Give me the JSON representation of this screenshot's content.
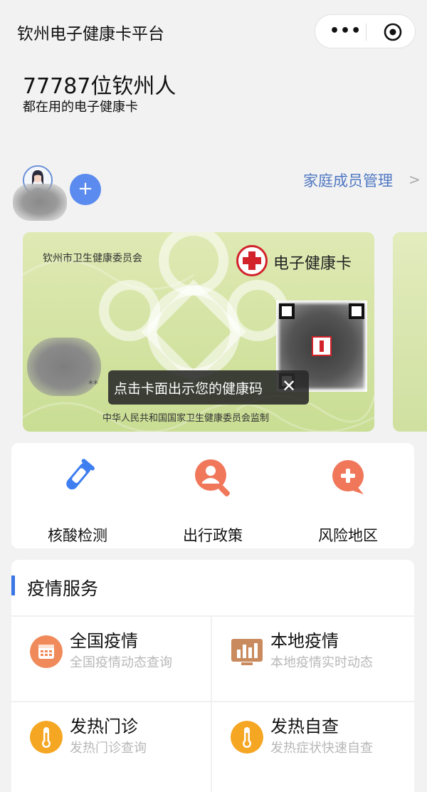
{
  "header": {
    "title": "钦州电子健康卡平台",
    "more_label": "•••"
  },
  "intro": {
    "count_line": "77787位钦州人",
    "sub_line": "都在用的电子健康卡"
  },
  "family": {
    "add_label": "+",
    "manage_link": "家庭成员管理",
    "chevron": ">"
  },
  "card": {
    "issuer": "钦州市卫生健康委员会",
    "card_name": "电子健康卡",
    "masked_id": "**",
    "tooltip": "点击卡面出示您的健康码",
    "tooltip_close": "✕",
    "footer": "中华人民共和国国家卫生健康委员会监制"
  },
  "quick_actions": [
    {
      "label": "核酸检测",
      "icon": "test-tube-icon",
      "color": "#3e7ef0"
    },
    {
      "label": "出行政策",
      "icon": "person-search-icon",
      "color": "#f0775a"
    },
    {
      "label": "风险地区",
      "icon": "plus-bubble-icon",
      "color": "#f0775a"
    }
  ],
  "services": {
    "section_title": "疫情服务",
    "accent_color": "#3a77e6",
    "items": [
      {
        "title": "全国疫情",
        "subtitle": "全国疫情动态查询",
        "icon": "calendar-icon",
        "color": "#f08a5a"
      },
      {
        "title": "本地疫情",
        "subtitle": "本地疫情实时动态",
        "icon": "bar-chart-icon",
        "color": "#c98b5e"
      },
      {
        "title": "发热门诊",
        "subtitle": "发热门诊查询",
        "icon": "thermometer-icon",
        "color": "#f5a623"
      },
      {
        "title": "发热自查",
        "subtitle": "发热症状快速自查",
        "icon": "thermometer-icon",
        "color": "#f5a623"
      }
    ]
  }
}
